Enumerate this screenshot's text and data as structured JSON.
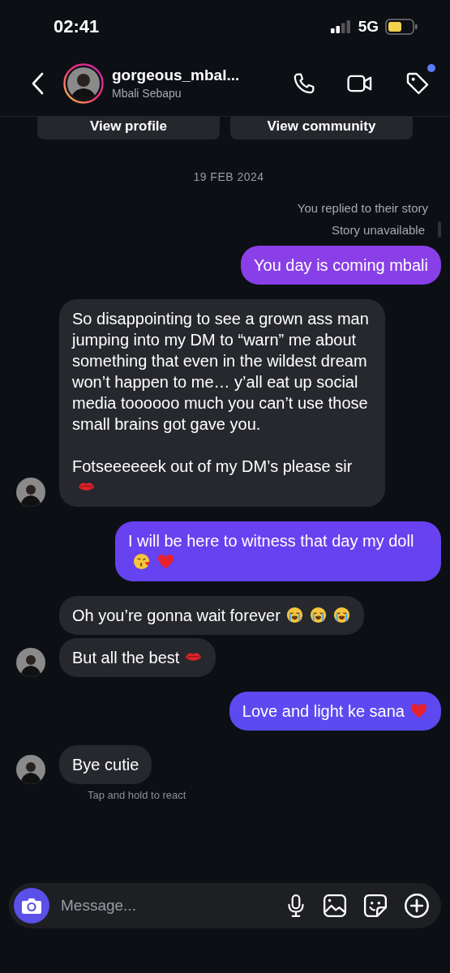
{
  "status_bar": {
    "time": "02:41",
    "network": "5G"
  },
  "header": {
    "username": "gorgeous_mbal...",
    "name": "Mbali Sebapu",
    "notification_dot": true
  },
  "profile_buttons": [
    "View profile",
    "View community"
  ],
  "date": "19 FEB 2024",
  "story_reply": {
    "label": "You replied to their story",
    "status": "Story unavailable"
  },
  "messages": [
    {
      "kind": "sent",
      "text": "You day is coming mbali"
    },
    {
      "kind": "received",
      "text": "So disappointing to see a grown ass man jumping into my DM to “warn” me about something that even in the wildest dream won’t happen to me… y’all eat up social media toooooo much you can’t use those small brains got gave you.\n\nFotseeeeeek out of my DM’s please sir",
      "emoji": [
        {
          "kind": "lips"
        }
      ],
      "avatar": true
    },
    {
      "kind": "sent",
      "text": "I will be here to witness that day my doll",
      "emoji": [
        {
          "kind": "kiss"
        },
        {
          "kind": "heart"
        }
      ]
    },
    {
      "kind": "received",
      "text": "Oh you’re gonna wait forever",
      "emoji": [
        {
          "kind": "crying"
        },
        {
          "kind": "crying"
        },
        {
          "kind": "crying"
        }
      ],
      "avatar": false
    },
    {
      "kind": "received",
      "text": "But all the best",
      "emoji": [
        {
          "kind": "lips"
        }
      ],
      "avatar": true
    },
    {
      "kind": "sent",
      "text": "Love and light ke sana",
      "emoji": [
        {
          "kind": "heart"
        }
      ]
    },
    {
      "kind": "received",
      "text": "Bye cutie",
      "avatar": true
    }
  ],
  "react_hint": "Tap and hold to react",
  "composer": {
    "placeholder": "Message..."
  }
}
